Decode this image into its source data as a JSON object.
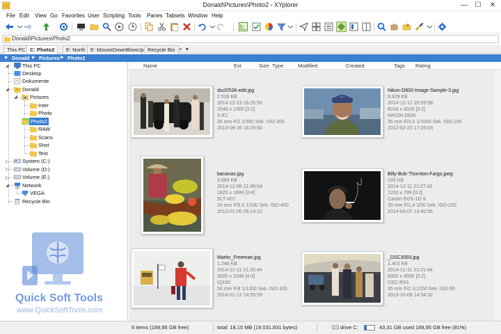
{
  "window": {
    "title": "Donald\\Pictures\\Photo2 - XYplorer",
    "min": "—",
    "max": "☐",
    "close": "✕"
  },
  "menu": [
    "File",
    "Edit",
    "View",
    "Go",
    "Favorites",
    "User",
    "Scripting",
    "Tools",
    "Panes",
    "Tabsets",
    "Window",
    "Help"
  ],
  "address": {
    "value": "Donald\\Pictures\\Photo2"
  },
  "tabs": [
    {
      "label": "This PC",
      "active": false
    },
    {
      "label": "C: Photo2",
      "active": true
    },
    {
      "label": "E: North",
      "active": false
    },
    {
      "label": "E: MouseDownBlowUp",
      "active": false
    },
    {
      "label": "Recycle Bin",
      "active": false
    }
  ],
  "tab_add": "+",
  "tab_menu": "▾",
  "breadcrumb": [
    "Donald",
    "Pictures",
    "Photo2"
  ],
  "tree": {
    "this_pc": "This PC",
    "desktop": "Desktop",
    "dokumente": "Dokumente",
    "donald": "Donald",
    "pictures": "Pictures",
    "inter": "Inter",
    "photo": "Photo",
    "photo2": "Photo2",
    "raw": "RAW",
    "scans": "Scans",
    "shot": "Shot",
    "test": "Test",
    "system_c": "System (C:)",
    "volume_d": "Volume (D:)",
    "volume_e": "Volume (E:)",
    "network": "Network",
    "vega": "VEGA",
    "recycle_bin": "Recycle Bin"
  },
  "columns": [
    "Name",
    "Ext",
    "Size",
    "Type",
    "Modified",
    "Created",
    "Tags",
    "Rating"
  ],
  "files": [
    {
      "name": "dscf2536-edit.jpg",
      "size": "2.528 KB",
      "date": "2014-12-13 15:25:55",
      "dims": "2048 x 1365 [3:2]",
      "camera": "X-E1",
      "exposure": "35 mm  F/2  1/550 Sek.  ISO-200",
      "created": "2013-09-26 16:29:50"
    },
    {
      "name": "Nikon-D600-Image-Sample-3.jpg",
      "size": "9.929 KB",
      "date": "2014-12-12 20:55:58",
      "dims": "6016 x 4016 [3:2]",
      "camera": "NIKON D600",
      "exposure": "35 mm  F/4,5  1/1000 Sek.  ISO-100",
      "created": "2012-02-23 17:28:03"
    },
    {
      "name": "bananas.jpg",
      "size": "3.683 KB",
      "date": "2014-12-08 21:08:54",
      "dims": "1825 x 1899 [3:4]",
      "camera": "SLT-A57",
      "exposure": "24 mm  F/5.6  1/100 Sek.  ISO-400",
      "created": "2013-01-05 05:14:12"
    },
    {
      "name": "Billy-Bob-Thornton-Fargo.jpeg",
      "size": "133 KB",
      "date": "2014-12-11 21:27:42",
      "dims": "1200 x 799 [3:2]",
      "camera": "Canon EOS-1D X",
      "exposure": "35 mm  F/1,4  1/50 Sek.  ISO-200",
      "created": "2014-03-07 13:40:56"
    },
    {
      "name": "Martin_Freeman.jpg",
      "size": "1.248 KB",
      "date": "2014-12-11 21:25:44",
      "dims": "3000 x 2248 [4:3]",
      "camera": "IQ160",
      "exposure": "50 mm  F/8  1/1200 Sek.  ISO-100",
      "created": "2014-01-12 14:55:59"
    },
    {
      "name": "_DSC3003.jpg",
      "size": "1.403 KB",
      "date": "2014-12-11 21:21:44",
      "dims": "6000 x 4000 [3:2]",
      "camera": "DSC-RX1",
      "exposure": "35 mm  F/2  1/1250 Sek.  ISO-50",
      "created": "2013-10-09 14:34:32"
    }
  ],
  "status": {
    "items": "6 items (189,95 GB free)",
    "total": "total: 18,15 MB (19.031.831 bytes)",
    "drive": "drive C:",
    "used": "43,31 GB used",
    "free": "189,95 GB free (81%)",
    "used_fraction": 0.19
  },
  "watermark": {
    "title": "Quick Soft Tools",
    "subtitle": "www.QuickSoftTools.com"
  },
  "colors": {
    "accent": "#3b7fd0",
    "folder": "#f2c94c",
    "selected_folder": "#8cc63f"
  }
}
